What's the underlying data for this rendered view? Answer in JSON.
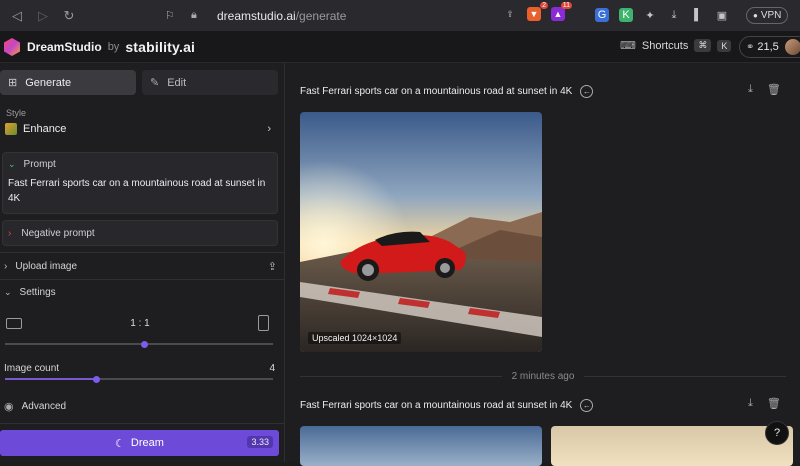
{
  "browser": {
    "url_host": "dreamstudio.ai",
    "url_path": "/generate",
    "ext_badge_1": "2",
    "ext_badge_2": "11",
    "vpn_label": "VPN"
  },
  "header": {
    "brand": "DreamStudio",
    "by": "by",
    "company": "stability.ai",
    "shortcuts_label": "Shortcuts",
    "kbd_cmd": "⌘",
    "kbd_k": "K",
    "credits": "21,5"
  },
  "sidebar": {
    "tab_generate": "Generate",
    "tab_edit": "Edit",
    "style_label": "Style",
    "style_value": "Enhance",
    "prompt_label": "Prompt",
    "prompt_text": "Fast Ferrari sports car on a mountainous road at sunset in 4K",
    "negative_prompt_label": "Negative prompt",
    "upload_image_label": "Upload image",
    "settings_label": "Settings",
    "aspect_ratio": "1 : 1",
    "aspect_ratio_position": 0.52,
    "image_count_label": "Image count",
    "image_count_value": "4",
    "image_count_position": 0.34,
    "advanced_label": "Advanced",
    "dream_label": "Dream",
    "dream_cost": "3.33"
  },
  "main": {
    "generations": [
      {
        "prompt": "Fast Ferrari sports car on a mountainous road at sunset in 4K",
        "upscaled_label": "Upscaled 1024×1024"
      },
      {
        "prompt": "Fast Ferrari sports car on a mountainous road at sunset in 4K"
      }
    ],
    "time_label": "2 minutes ago"
  },
  "help_label": "?",
  "colors": {
    "accent": "#6d4bd8",
    "background": "#1e1e21"
  }
}
